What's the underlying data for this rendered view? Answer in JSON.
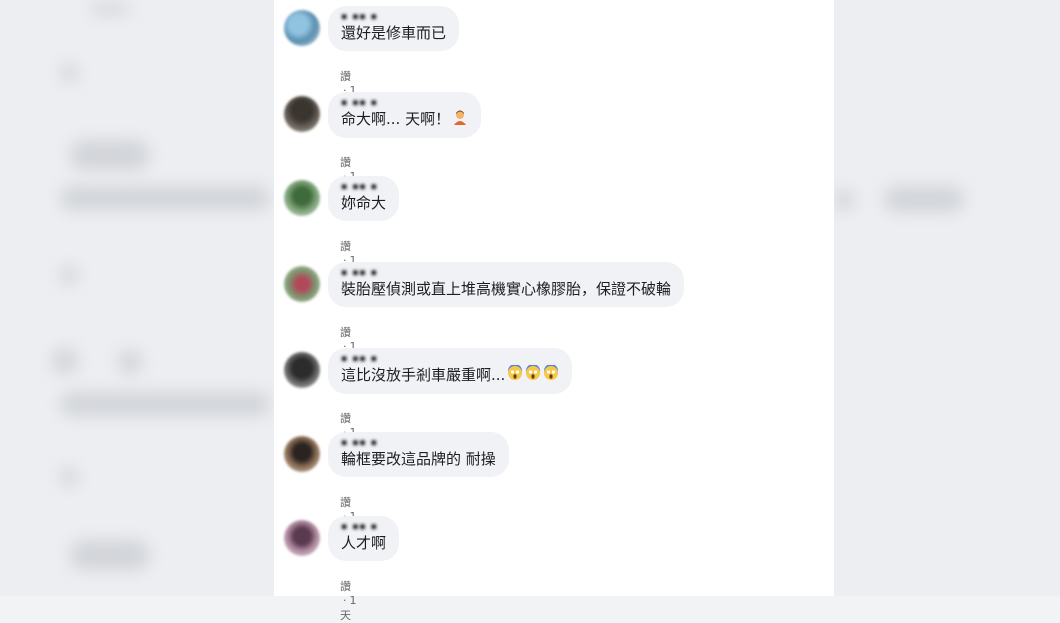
{
  "comments": [
    {
      "name": "",
      "text": "還好是修車而已",
      "action": "讚",
      "time": "1天",
      "emoji": []
    },
    {
      "name": "",
      "text": "命大啊... 天啊！",
      "action": "讚",
      "time": "1天",
      "emoji": [
        "person-facepalm-emoji"
      ]
    },
    {
      "name": "",
      "text": "妳命大",
      "action": "讚",
      "time": "1天",
      "emoji": []
    },
    {
      "name": "",
      "text": "裝胎壓偵測或直上堆高機實心橡膠胎，保證不破輪",
      "action": "讚",
      "time": "1天",
      "emoji": []
    },
    {
      "name": "",
      "text": "這比沒放手剎車嚴重啊...",
      "action": "讚",
      "time": "1天",
      "emoji": [
        "scream-emoji",
        "scream-emoji",
        "scream-emoji"
      ]
    },
    {
      "name": "",
      "text": "輪框要改這品牌的 耐操",
      "action": "讚",
      "time": "1天",
      "emoji": []
    },
    {
      "name": "",
      "text": "人才啊",
      "action": "讚",
      "time": "1天",
      "emoji": []
    }
  ],
  "colors": {
    "bubble": "#f0f2f5",
    "meta_text": "#65676b",
    "comment_text": "#1c1e21"
  }
}
